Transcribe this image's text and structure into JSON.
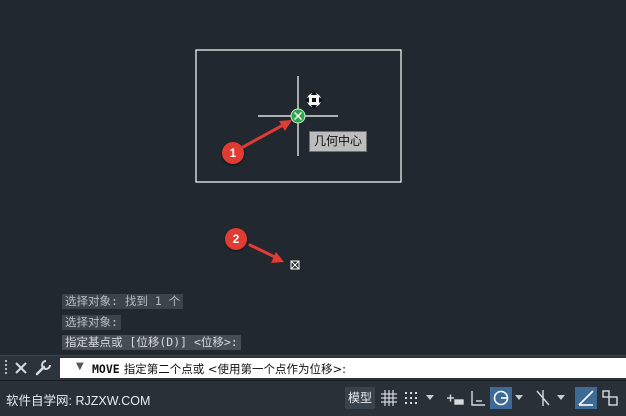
{
  "canvas": {
    "tooltip": "几何中心",
    "markers": [
      {
        "label": "1"
      },
      {
        "label": "2"
      }
    ],
    "colors": {
      "background": "#212830",
      "geometry": "#ffffff",
      "snap": "#2fa34a",
      "annotation": "#e03c33"
    }
  },
  "history": [
    "选择对象: 找到 1 个",
    "选择对象:",
    "指定基点或 [位移(D)] <位移>:"
  ],
  "command": {
    "name": "MOVE",
    "prompt": "指定第二个点或 <使用第一个点作为位移>:"
  },
  "statusbar": {
    "watermark": "软件自学网: RJZXW.COM",
    "model_label": "模型",
    "icons": [
      "grid-icon",
      "snap-grid-icon",
      "infer-constraints-icon",
      "dynamic-input-icon",
      "ortho-icon",
      "polar-tracking-icon",
      "isodraft-icon",
      "object-snap-tracking-icon",
      "osnap-icon"
    ]
  }
}
